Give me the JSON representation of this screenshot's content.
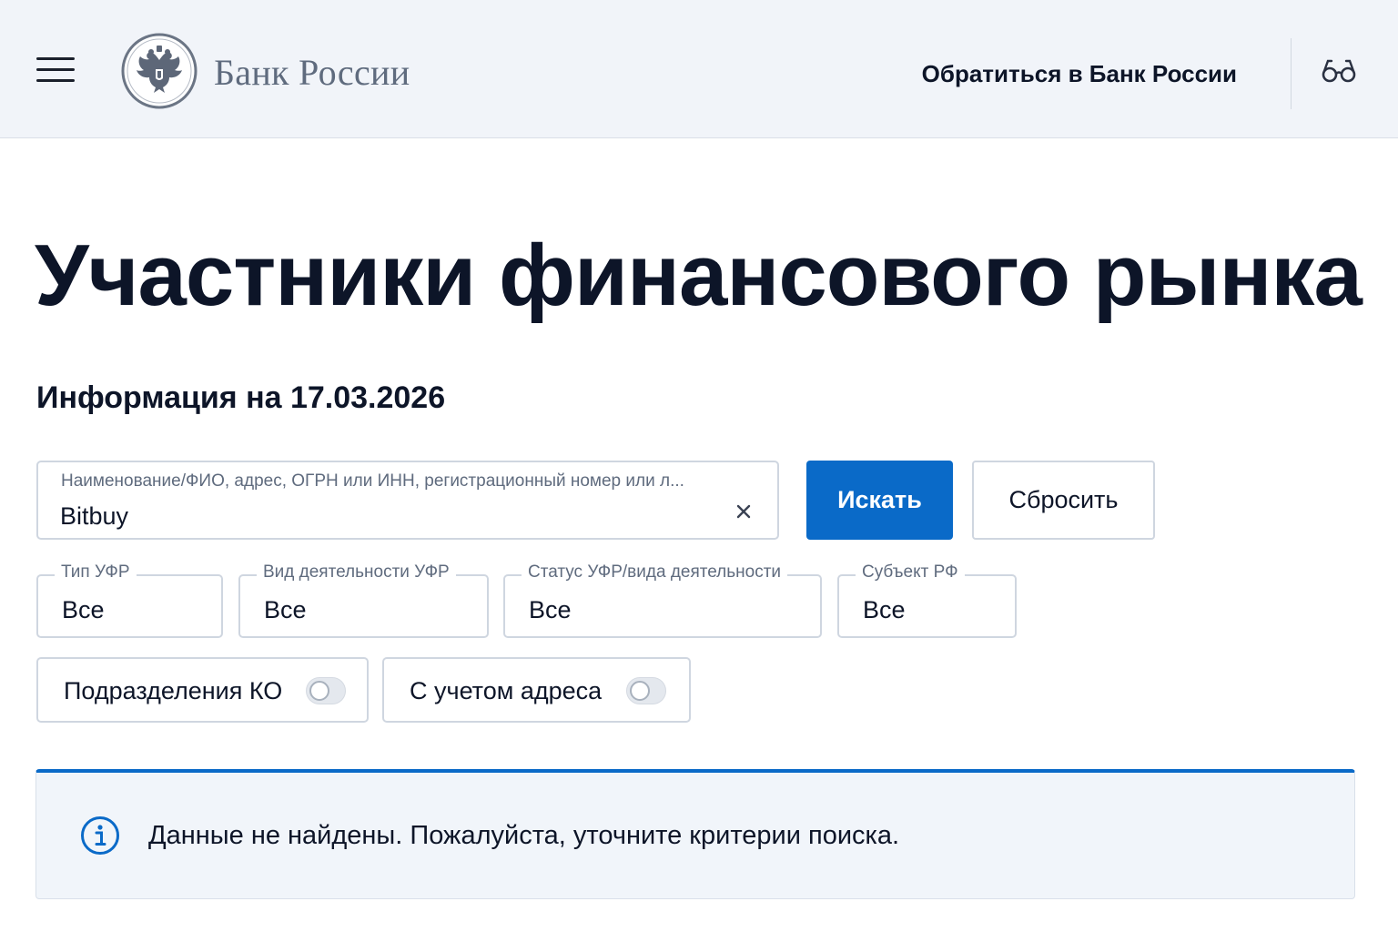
{
  "header": {
    "bank_name": "Банк России",
    "contact_label": "Обратиться в Банк России",
    "icons": [
      "menu-icon",
      "emblem-icon",
      "glasses-icon"
    ]
  },
  "main": {
    "title": "Участники финансового рынка",
    "info_date": "Информация на 17.03.2026"
  },
  "search": {
    "label": "Наименование/ФИО, адрес, ОГРН или ИНН, регистрационный номер или л...",
    "value": "Bitbuy",
    "search_button": "Искать",
    "reset_button": "Сбросить"
  },
  "filters": [
    {
      "label": "Тип УФР",
      "value": "Все"
    },
    {
      "label": "Вид деятельности УФР",
      "value": "Все"
    },
    {
      "label": "Статус УФР/вида деятельности",
      "value": "Все"
    },
    {
      "label": "Субъект РФ",
      "value": "Все"
    }
  ],
  "toggles": [
    {
      "label": "Подразделения КО",
      "checked": false
    },
    {
      "label": "С учетом адреса",
      "checked": false
    }
  ],
  "notice": {
    "text": "Данные не найдены. Пожалуйста, уточните критерии поиска."
  },
  "colors": {
    "accent": "#0a6ac8",
    "header_bg": "#f1f4f9",
    "text": "#0d1528",
    "muted": "#5f6b7e"
  }
}
